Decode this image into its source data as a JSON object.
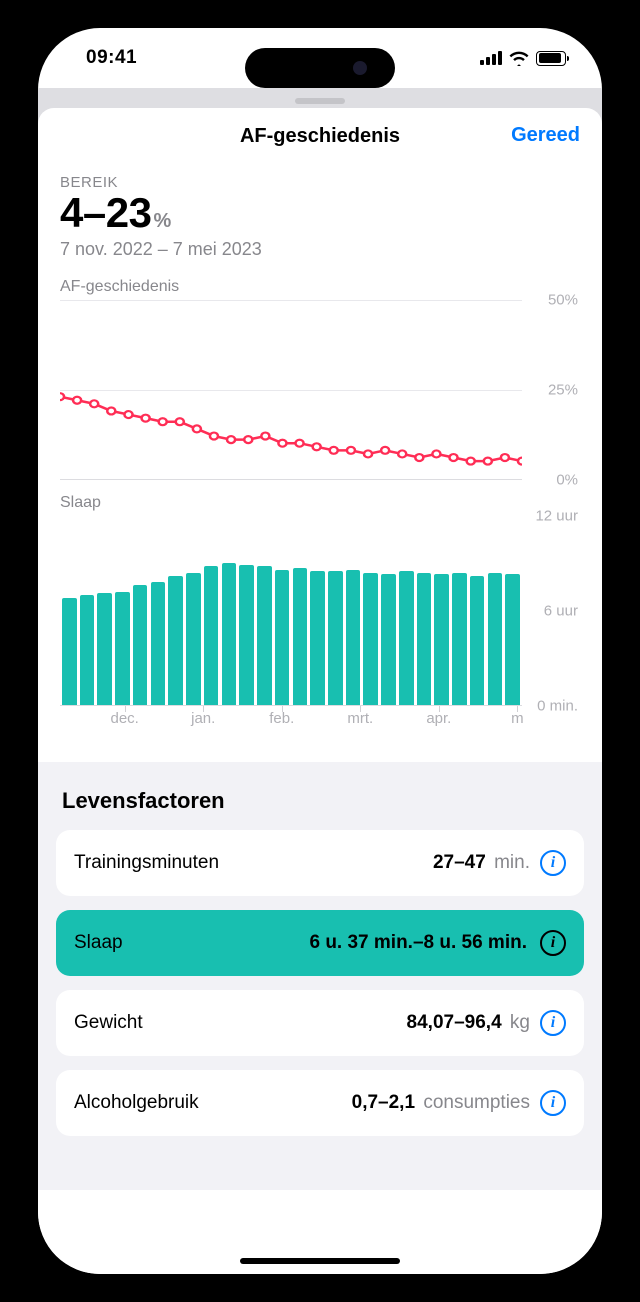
{
  "status": {
    "time": "09:41"
  },
  "sheet": {
    "title": "AF-geschiedenis",
    "done": "Gereed"
  },
  "range": {
    "label": "BEREIK",
    "value": "4–23",
    "unit": "%",
    "dates": "7 nov. 2022 – 7 mei 2023"
  },
  "chart_data": [
    {
      "type": "line",
      "title": "AF-geschiedenis",
      "ylabel": "",
      "ylim": [
        0,
        50
      ],
      "y_ticks": [
        "50%",
        "25%",
        "0%"
      ],
      "x_ticks": [
        "dec.",
        "jan.",
        "feb.",
        "mrt.",
        "apr.",
        "m"
      ],
      "series": [
        {
          "name": "AF-geschiedenis",
          "values": [
            23,
            22,
            21,
            19,
            18,
            17,
            16,
            16,
            14,
            12,
            11,
            11,
            12,
            10,
            10,
            9,
            8,
            8,
            7,
            8,
            7,
            6,
            7,
            6,
            5,
            5,
            6,
            5
          ]
        }
      ]
    },
    {
      "type": "bar",
      "title": "Slaap",
      "ylabel": "",
      "ylim": [
        0,
        12
      ],
      "y_ticks": [
        "12 uur",
        "6 uur",
        "0 min."
      ],
      "x_ticks": [
        "dec.",
        "jan.",
        "feb.",
        "mrt.",
        "apr.",
        "m"
      ],
      "series": [
        {
          "name": "Slaap",
          "values": [
            6.8,
            7.0,
            7.1,
            7.2,
            7.6,
            7.8,
            8.2,
            8.4,
            8.8,
            9.0,
            8.9,
            8.8,
            8.6,
            8.7,
            8.5,
            8.5,
            8.6,
            8.4,
            8.3,
            8.5,
            8.4,
            8.3,
            8.4,
            8.2,
            8.4,
            8.3
          ]
        }
      ]
    }
  ],
  "factors": {
    "title": "Levensfactoren",
    "items": [
      {
        "name": "Trainingsminuten",
        "value": "27–47",
        "unit": " min.",
        "active": false
      },
      {
        "name": "Slaap",
        "value": "6 u. 37 min.–8 u. 56 min.",
        "unit": "",
        "active": true
      },
      {
        "name": "Gewicht",
        "value": "84,07–96,4",
        "unit": " kg",
        "active": false
      },
      {
        "name": "Alcoholgebruik",
        "value": "0,7–2,1",
        "unit": " consumpties",
        "active": false
      }
    ]
  }
}
